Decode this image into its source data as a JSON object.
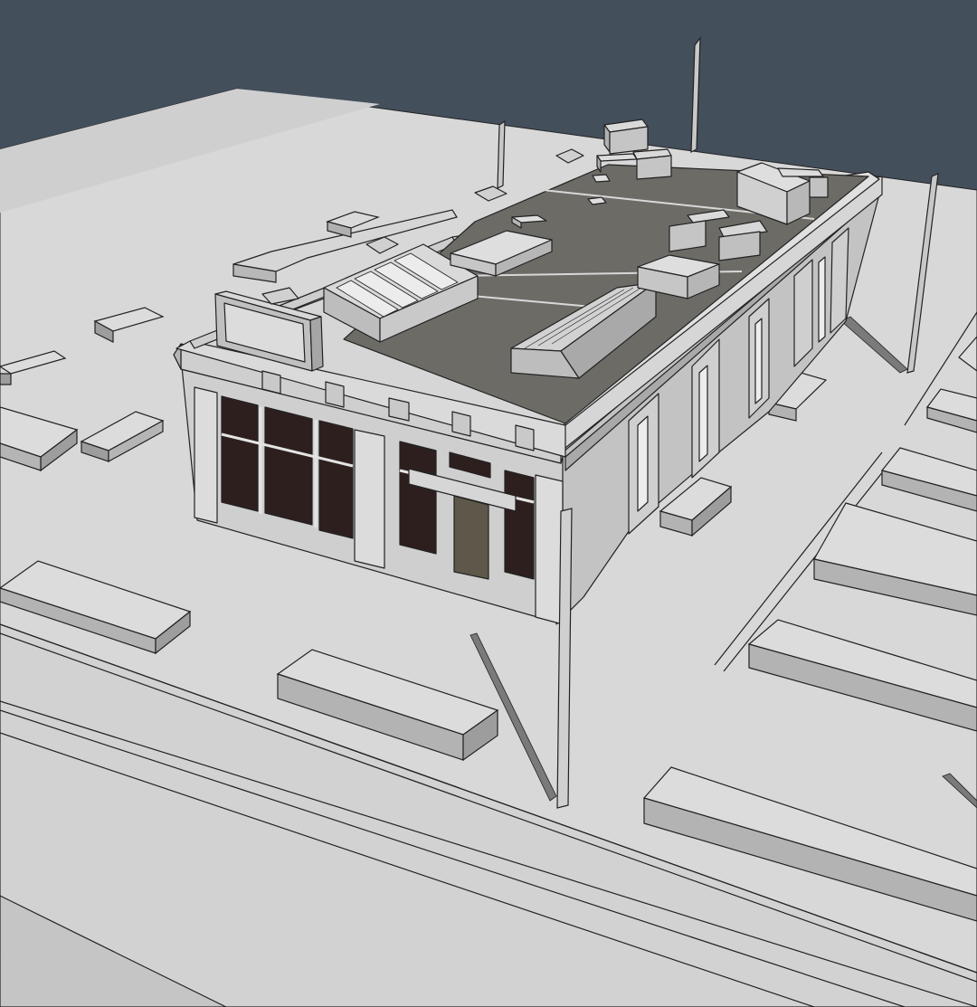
{
  "scene": {
    "subject": "3d-model-viewport",
    "colors": {
      "sky": "#444f5c",
      "ground": "#d8d8d8",
      "ground_shade": "#c9c9c9",
      "curb_top": "#dcdcdc",
      "curb_side": "#9d9d9d",
      "wall_light": "#d4d4d4",
      "wall_mid": "#bdbdbd",
      "wall_dark": "#a9a9a9",
      "roof": "#6d6b66",
      "roof_line": "#d8d8d8",
      "window": "#2e1f1f",
      "door": "#5e584a",
      "glass": "#ececec",
      "shadow": "#7a7a7a",
      "edge": "#222222"
    }
  }
}
